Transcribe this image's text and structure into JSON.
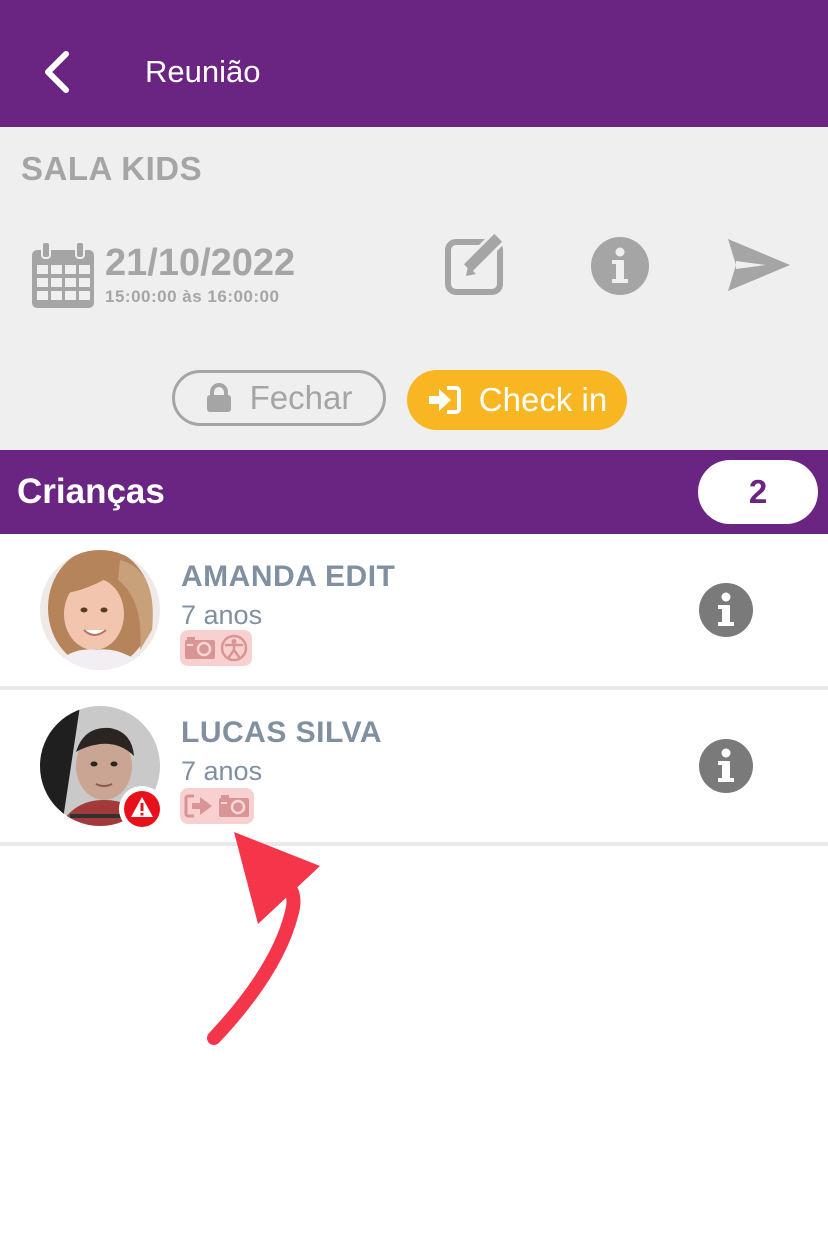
{
  "header": {
    "title": "Reunião",
    "back_icon": "chevron-left-icon"
  },
  "room": {
    "name": "SALA KIDS",
    "date": "21/10/2022",
    "time": "15:00:00 às 16:00:00",
    "actions": [
      "edit-icon",
      "info-icon",
      "send-icon"
    ]
  },
  "buttons": {
    "fechar": "Fechar",
    "checkin": "Check in"
  },
  "section": {
    "title": "Crianças",
    "count": "2"
  },
  "children": [
    {
      "name": "AMANDA EDIT",
      "age": "7 anos",
      "status_icons": [
        "camera-icon",
        "accessibility-icon"
      ],
      "alert": false
    },
    {
      "name": "LUCAS SILVA",
      "age": "7 anos",
      "status_icons": [
        "checkout-icon",
        "camera-icon"
      ],
      "alert": true
    }
  ],
  "colors": {
    "primary": "#6a2583",
    "accent": "#f9b623",
    "muted": "#a5a5a5",
    "name_text": "#8190a0",
    "alert": "#e8101b",
    "annotation": "#f5354a"
  }
}
